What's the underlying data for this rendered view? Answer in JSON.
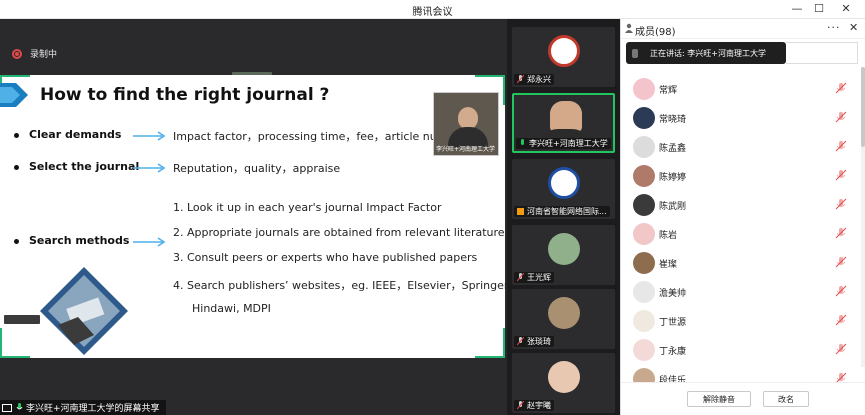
{
  "window": {
    "title": "腾讯会议"
  },
  "recording": {
    "label": "录制中"
  },
  "slide": {
    "title": "How to find the right journal ?",
    "rows": [
      {
        "label": "Clear demands",
        "text": "Impact factor，processing time，fee，article number"
      },
      {
        "label": "Select the journal",
        "text": "Reputation，quality，appraise"
      },
      {
        "label": "Search methods"
      }
    ],
    "methods": [
      "1.   Look it up in each year's journal Impact Factor",
      "2.   Appropriate journals are obtained from relevant literature",
      "3.   Consult peers or experts who have published papers",
      "4.   Search publishers’  websites，eg. IEEE，Elsevier，Springer",
      "Hindawi, MDPI"
    ]
  },
  "share_label": "李兴旺+河南理工大学的屏幕共享",
  "video_tiles": [
    {
      "name": "郑永兴",
      "avatar_color": "#c0392b"
    },
    {
      "name": "李兴旺+河南理工大学",
      "avatar_color": "#d4a98a"
    },
    {
      "name": "河南省智能网络国际...",
      "avatar_color": "#1e4fa3"
    },
    {
      "name": "王光辉",
      "avatar_color": "#8fb08a"
    },
    {
      "name": "张琰琦",
      "avatar_color": "#a89070"
    },
    {
      "name": "赵宇曦",
      "avatar_color": "#e8c8b0"
    }
  ],
  "members_panel": {
    "title": "成员(98)",
    "speaking_tip": "正在讲话: 李兴旺+河南理工大学",
    "members": [
      {
        "name": "常辉",
        "color": "#f3c4cc"
      },
      {
        "name": "常晓琦",
        "color": "#2b3a55"
      },
      {
        "name": "陈孟鑫",
        "color": "#dcdcdc"
      },
      {
        "name": "陈婷婷",
        "color": "#b07a6a"
      },
      {
        "name": "陈武刚",
        "color": "#3a3a3a"
      },
      {
        "name": "陈岩",
        "color": "#f2c7c7"
      },
      {
        "name": "崔璨",
        "color": "#8e6c4e"
      },
      {
        "name": "澹美帅",
        "color": "#e7e7e7"
      },
      {
        "name": "丁世源",
        "color": "#efe9e0"
      },
      {
        "name": "丁永康",
        "color": "#f4d9d9"
      },
      {
        "name": "段佳乐",
        "color": "#c9a98d"
      }
    ],
    "mute_all_label": "解除静音",
    "rename_label": "改名"
  }
}
